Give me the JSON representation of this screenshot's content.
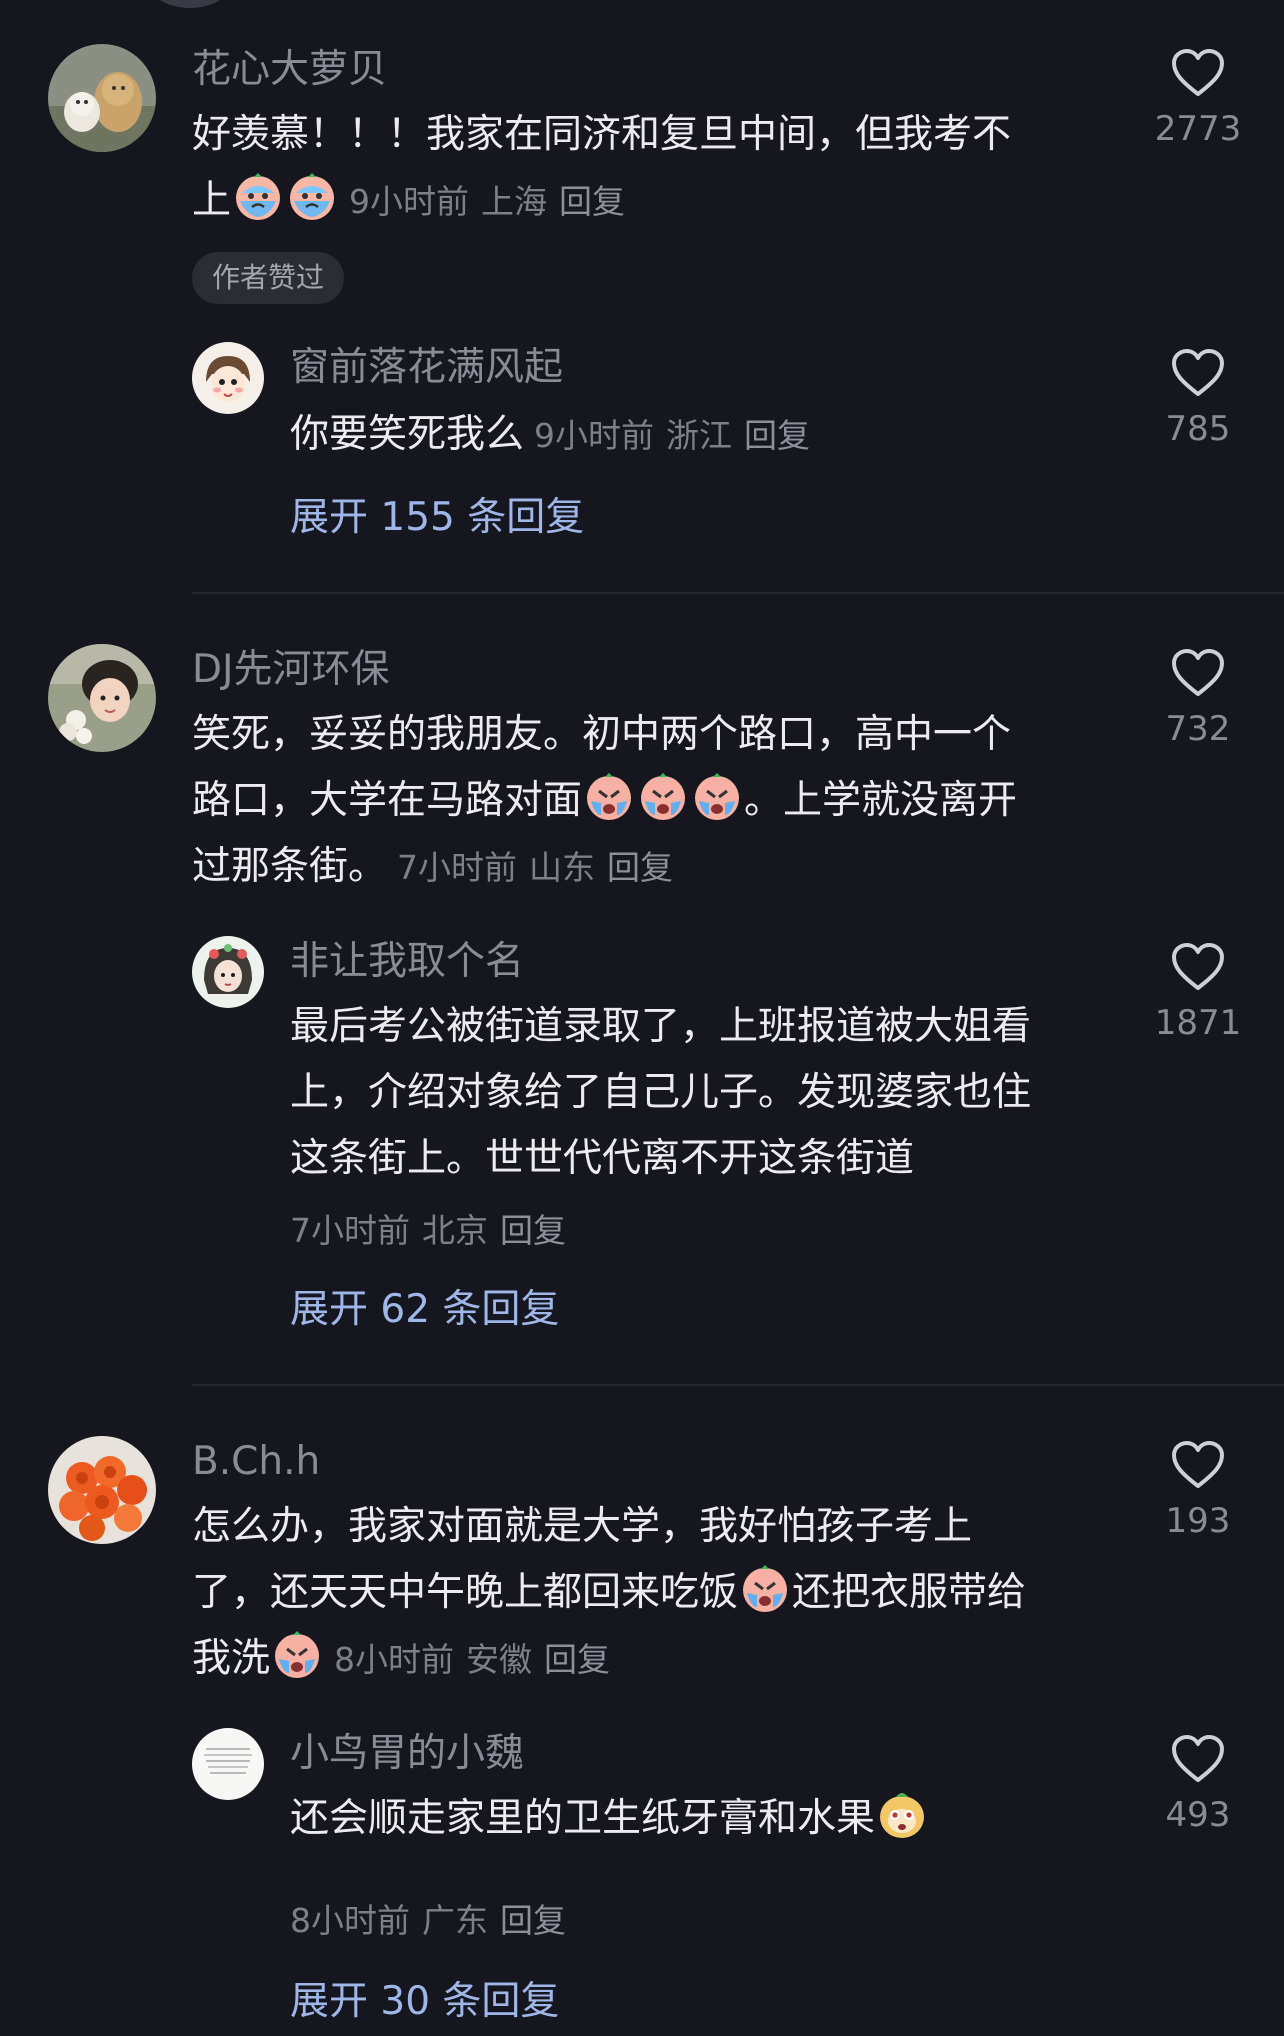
{
  "comments": [
    {
      "username": "花心大萝贝",
      "text_line1": "好羡慕！！！我家在同济和复旦中间，但我考不",
      "text_line2": "上",
      "time": "9小时前",
      "location": "上海",
      "reply_label": "回复",
      "likes": "2773",
      "badge": "作者赞过",
      "reply": {
        "username": "窗前落花满风起",
        "text": "你要笑死我么",
        "time": "9小时前",
        "location": "浙江",
        "reply_label": "回复",
        "likes": "785"
      },
      "expand_label": "展开 155 条回复"
    },
    {
      "username": "DJ先河环保",
      "text_line1": "笑死，妥妥的我朋友。初中两个路口，高中一个",
      "text_line2a": "路口，大学在马路对面",
      "text_line2b": "。上学就没离开",
      "text_line3": "过那条街。",
      "time": "7小时前",
      "location": "山东",
      "reply_label": "回复",
      "likes": "732",
      "reply": {
        "username": "非让我取个名",
        "text_line1": "最后考公被街道录取了，上班报道被大姐看",
        "text_line2": "上，介绍对象给了自己儿子。发现婆家也住",
        "text_line3": "这条街上。世世代代离不开这条街道",
        "time": "7小时前",
        "location": "北京",
        "reply_label": "回复",
        "likes": "1871"
      },
      "expand_label": "展开 62 条回复"
    },
    {
      "username": "B.Ch.h",
      "text_line1": "怎么办，我家对面就是大学，我好怕孩子考上",
      "text_line2a": "了，还天天中午晚上都回来吃饭",
      "text_line2b": "还把衣服带给",
      "text_line3": "我洗",
      "time": "8小时前",
      "location": "安徽",
      "reply_label": "回复",
      "likes": "193",
      "reply": {
        "username": "小鸟胃的小魏",
        "text": "还会顺走家里的卫生纸牙膏和水果",
        "time": "8小时前",
        "location": "广东",
        "reply_label": "回复",
        "likes": "493"
      },
      "expand_label": "展开 30 条回复"
    }
  ],
  "colors": {
    "background": "#16161e",
    "username": "#8b8b95",
    "body_text": "#ececf0",
    "meta": "#7f7f88",
    "expand_link": "#9fb6e6"
  },
  "icons": [
    "heart-icon",
    "crying-emoji-icon",
    "sweating-emoji-icon"
  ]
}
